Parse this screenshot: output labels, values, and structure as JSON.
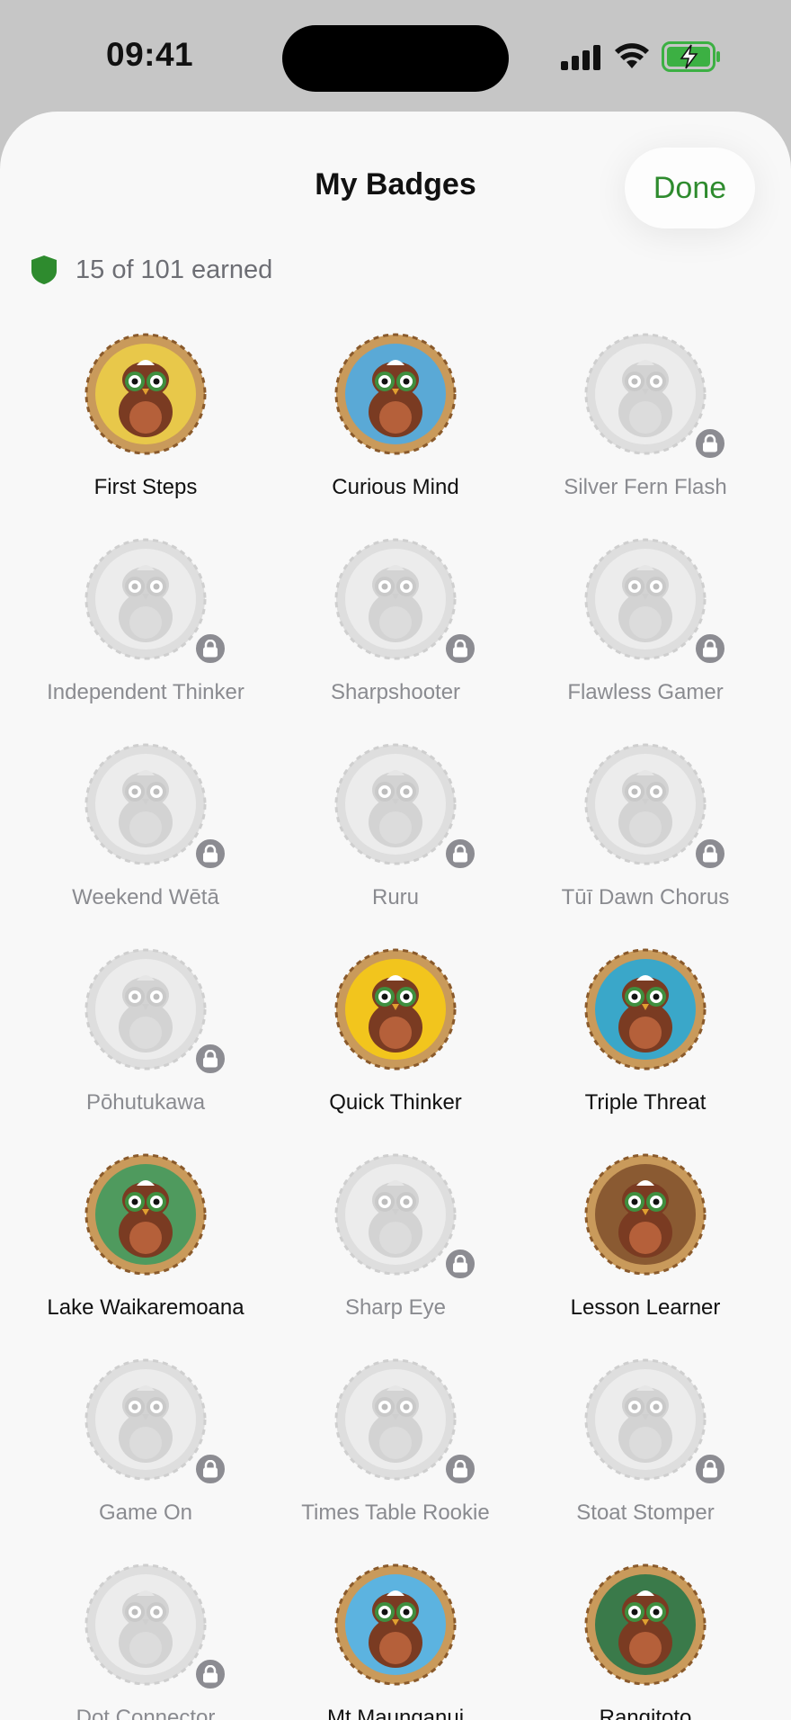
{
  "status": {
    "time": "09:41"
  },
  "sheet": {
    "title": "My Badges",
    "done_label": "Done",
    "earned_summary": "15 of 101 earned"
  },
  "colors": {
    "accent": "#2e8b2e",
    "locked": "#8a8b90",
    "earned_text": "#111111"
  },
  "badges": [
    {
      "name": "First Steps",
      "earned": true,
      "bg": "#e8c84a",
      "icon": "owl-confetti-icon"
    },
    {
      "name": "Curious Mind",
      "earned": true,
      "bg": "#5aa9d6",
      "icon": "owl-magnifier-icon"
    },
    {
      "name": "Silver Fern Flash",
      "earned": false,
      "icon": "fern-icon"
    },
    {
      "name": "Independent Thinker",
      "earned": false,
      "icon": "brain-owl-icon"
    },
    {
      "name": "Sharpshooter",
      "earned": false,
      "icon": "target-icon"
    },
    {
      "name": "Flawless Gamer",
      "earned": false,
      "icon": "diamond-icon"
    },
    {
      "name": "Weekend Wētā",
      "earned": false,
      "icon": "weta-icon"
    },
    {
      "name": "Ruru",
      "earned": false,
      "icon": "ruru-owl-icon"
    },
    {
      "name": "Tūī Dawn Chorus",
      "earned": false,
      "icon": "tui-bird-icon"
    },
    {
      "name": "Pōhutukawa",
      "earned": false,
      "icon": "tree-icon"
    },
    {
      "name": "Quick Thinker",
      "earned": true,
      "bg": "#f2c51d",
      "icon": "owl-lightbulb-icon"
    },
    {
      "name": "Triple Threat",
      "earned": true,
      "bg": "#3aa7c9",
      "icon": "lightning-icon"
    },
    {
      "name": "Lake Waikaremoana",
      "earned": true,
      "bg": "#4f9a5e",
      "icon": "owl-lake-icon"
    },
    {
      "name": "Sharp Eye",
      "earned": false,
      "icon": "stars-owl-icon"
    },
    {
      "name": "Lesson Learner",
      "earned": true,
      "bg": "#8a5a32",
      "icon": "owl-books-icon"
    },
    {
      "name": "Game On",
      "earned": false,
      "icon": "arcade-icon"
    },
    {
      "name": "Times Table Rookie",
      "earned": false,
      "icon": "multiply-icon"
    },
    {
      "name": "Stoat Stomper",
      "earned": false,
      "icon": "x7-icon"
    },
    {
      "name": "Dot Connector",
      "earned": false,
      "icon": "star-dots-icon"
    },
    {
      "name": "Mt Maunganui",
      "earned": true,
      "bg": "#5cb3e0",
      "icon": "owl-mountain-icon"
    },
    {
      "name": "Rangitoto",
      "earned": true,
      "bg": "#3a7a4a",
      "icon": "owl-island-icon"
    }
  ]
}
